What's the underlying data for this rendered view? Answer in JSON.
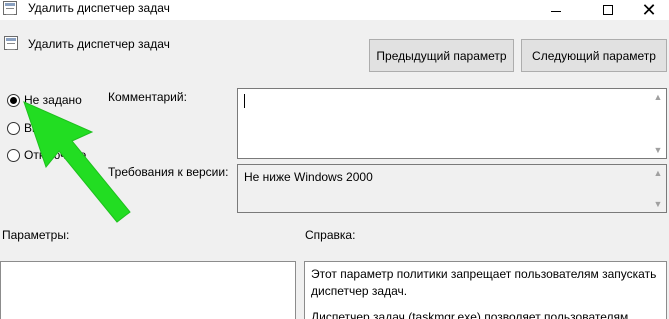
{
  "window": {
    "title": "Удалить диспетчер задач"
  },
  "header": {
    "policy_name": "Удалить диспетчер задач",
    "prev_button": "Предыдущий параметр",
    "next_button": "Следующий параметр"
  },
  "options": {
    "not_configured": "Не задано",
    "enabled": "Включено",
    "disabled": "Отключено",
    "selected": "not_configured"
  },
  "comment": {
    "label": "Комментарий:",
    "value": ""
  },
  "requirements": {
    "label": "Требования к версии:",
    "value": "Не ниже Windows 2000"
  },
  "sections": {
    "params_label": "Параметры:",
    "help_label": "Справка:"
  },
  "help": {
    "para1": "Этот параметр политики запрещает пользователям запускать диспетчер задач.",
    "para2": "Диспетчер задач (taskmgr.exe) позволяет пользователям"
  },
  "annotation": {
    "arrow_color": "#22dd22"
  },
  "colors": {
    "background": "#f0f0f0",
    "button_face": "#e1e1e1",
    "button_border": "#adadad"
  }
}
